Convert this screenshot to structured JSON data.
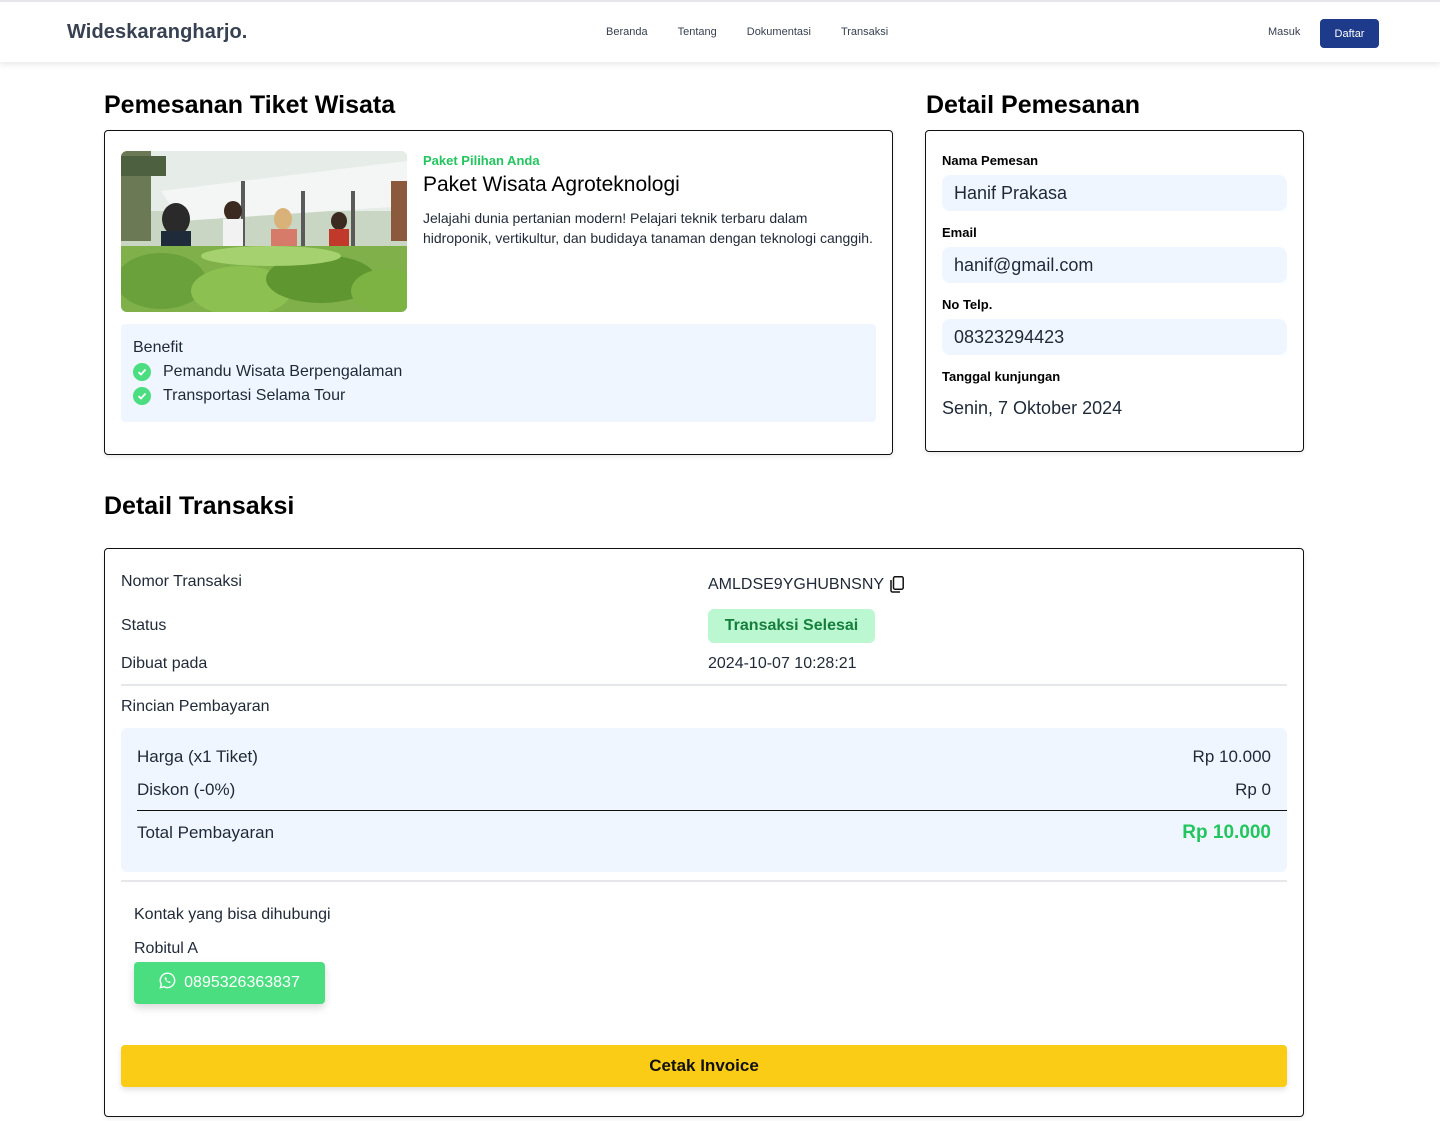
{
  "nav": {
    "brand": "Wideskarangharjo.",
    "links": [
      "Beranda",
      "Tentang",
      "Dokumentasi",
      "Transaksi"
    ],
    "login": "Masuk",
    "signup": "Daftar"
  },
  "ticket": {
    "section_title": "Pemesanan Tiket Wisata",
    "tag": "Paket Pilihan Anda",
    "name": "Paket Wisata Agroteknologi",
    "description": "Jelajahi dunia pertanian modern! Pelajari teknik terbaru dalam hidroponik, vertikultur, dan budidaya tanaman dengan teknologi canggih.",
    "benefit_title": "Benefit",
    "benefits": [
      "Pemandu Wisata Berpengalaman",
      "Transportasi Selama Tour"
    ]
  },
  "booking": {
    "section_title": "Detail Pemesanan",
    "name_label": "Nama Pemesan",
    "name_value": "Hanif Prakasa",
    "email_label": "Email",
    "email_value": "hanif@gmail.com",
    "phone_label": "No Telp.",
    "phone_value": "08323294423",
    "date_label": "Tanggal kunjungan",
    "date_value": "Senin, 7 Oktober 2024"
  },
  "transaction": {
    "section_title": "Detail Transaksi",
    "number_label": "Nomor Transaksi",
    "number_value": "AMLDSE9YGHUBNSNY",
    "status_label": "Status",
    "status_value": "Transaksi Selesai",
    "created_label": "Dibuat pada",
    "created_value": "2024-10-07 10:28:21",
    "payment_title": "Rincian Pembayaran",
    "price_label": "Harga (x1 Tiket)",
    "price_value": "Rp 10.000",
    "discount_label": "Diskon (-0%)",
    "discount_value": "Rp 0",
    "total_label": "Total Pembayaran",
    "total_value": "Rp 10.000",
    "contact_title": "Kontak yang bisa dihubungi",
    "contact_name": "Robitul A",
    "contact_phone": "0895326363837",
    "invoice_button": "Cetak Invoice"
  },
  "colors": {
    "accent_green": "#22c55e",
    "navy": "#1e3a8a",
    "invoice_yellow": "#facc15",
    "light_blue_bg": "#eff6ff"
  },
  "icons": [
    "check-circle-icon",
    "copy-icon",
    "whatsapp-icon"
  ]
}
